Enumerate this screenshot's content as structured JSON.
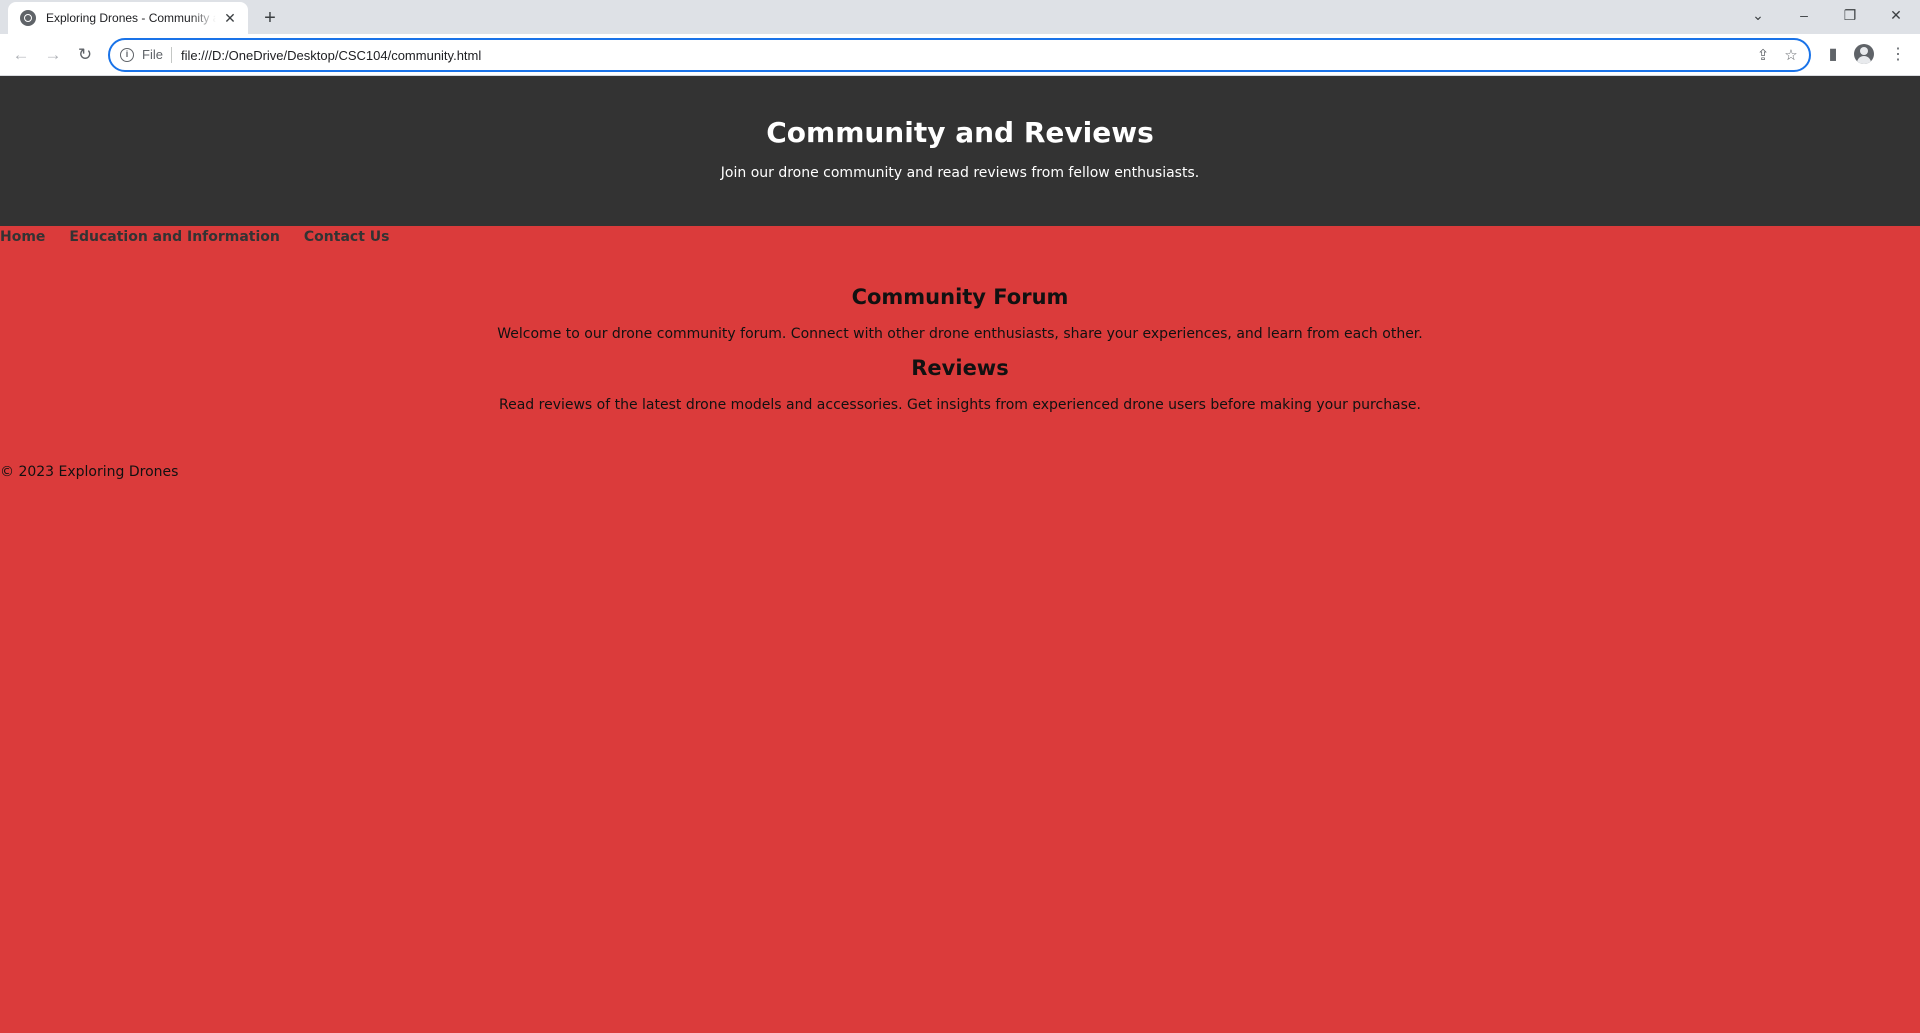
{
  "browser": {
    "tab_title": "Exploring Drones - Community and Reviews",
    "scheme_label": "File",
    "url": "file:///D:/OneDrive/Desktop/CSC104/community.html",
    "icons": {
      "back": "arrow-left-icon",
      "forward": "arrow-right-icon",
      "reload": "reload-icon",
      "site_info": "info-icon",
      "share": "share-icon",
      "bookmark": "star-icon",
      "side_panel": "side-panel-icon",
      "profile": "profile-icon",
      "menu": "kebab-menu-icon"
    }
  },
  "page": {
    "header": {
      "title": "Community and Reviews",
      "tagline": "Join our drone community and read reviews from fellow enthusiasts."
    },
    "nav": [
      {
        "label": "Home"
      },
      {
        "label": "Education and Information"
      },
      {
        "label": "Contact Us"
      }
    ],
    "sections": [
      {
        "heading": "Community Forum",
        "text": "Welcome to our drone community forum. Connect with other drone enthusiasts, share your experiences, and learn from each other."
      },
      {
        "heading": "Reviews",
        "text": "Read reviews of the latest drone models and accessories. Get insights from experienced drone users before making your purchase."
      }
    ],
    "footer": "© 2023 Exploring Drones"
  },
  "colors": {
    "page_background": "#db3b3b",
    "header_background": "#333333",
    "nav_link": "#333333",
    "omnibox_focus": "#1a73e8"
  }
}
